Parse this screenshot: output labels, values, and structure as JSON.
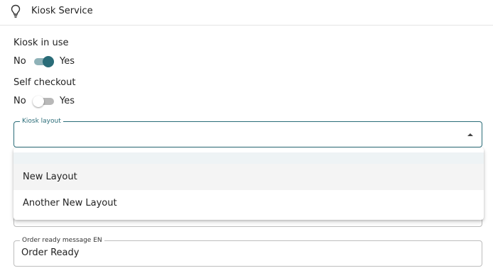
{
  "header": {
    "title": "Kiosk Service",
    "icon": "lightbulb-icon"
  },
  "kiosk_in_use": {
    "label": "Kiosk in use",
    "off_label": "No",
    "on_label": "Yes",
    "checked": true
  },
  "self_checkout": {
    "label": "Self checkout",
    "off_label": "No",
    "on_label": "Yes",
    "checked": false
  },
  "kiosk_layout": {
    "legend": "Kiosk layout",
    "value": "",
    "options": [
      "",
      "New Layout",
      "Another New Layout"
    ]
  },
  "order_ready_message": {
    "legend": "Order ready message EN",
    "value": "Order Ready"
  },
  "colors": {
    "accent": "#2a6c78",
    "accent_track": "#8fb2b8",
    "border": "#bdbdbd"
  }
}
